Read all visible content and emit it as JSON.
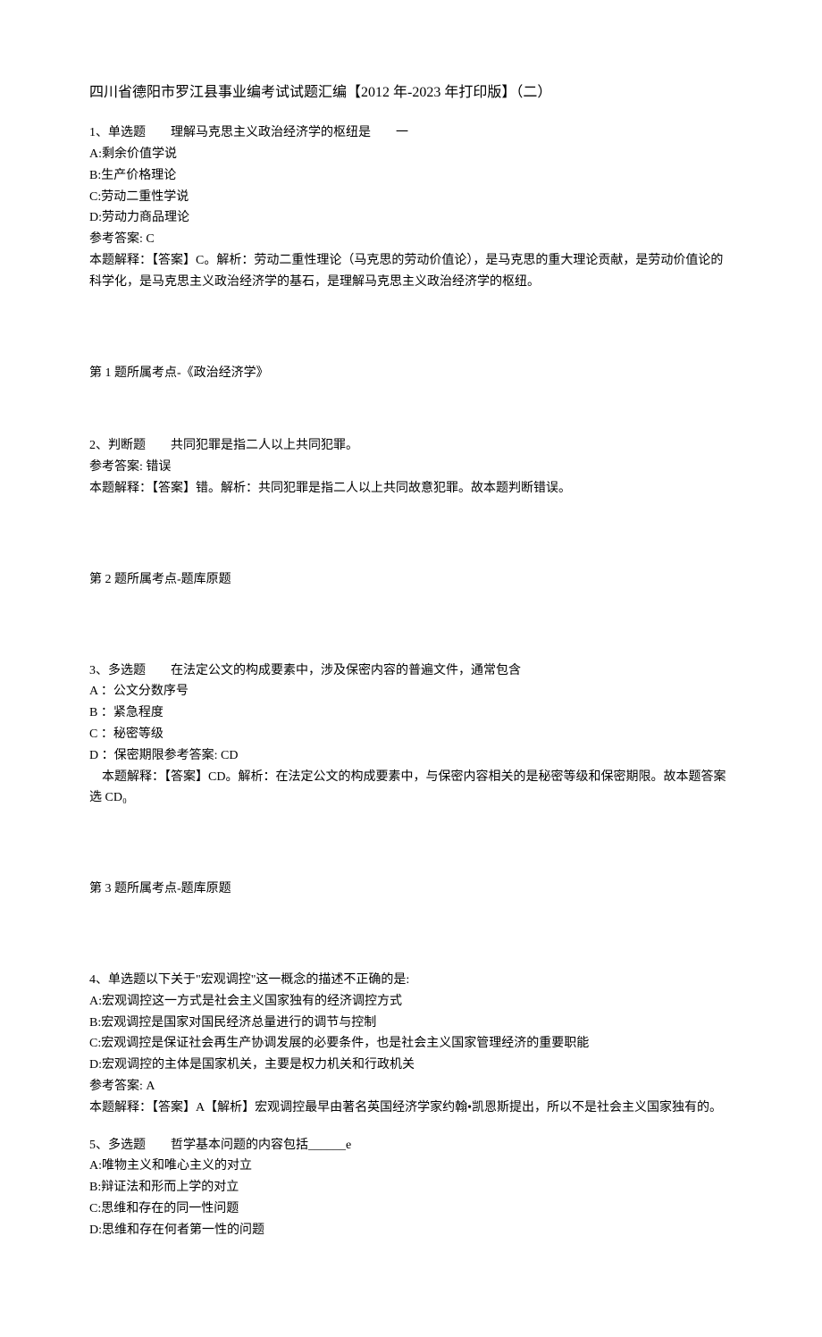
{
  "title": "四川省德阳市罗江县事业编考试试题汇编【2012 年-2023 年打印版】（二）",
  "q1": {
    "stem": "1、单选题　　理解马克思主义政治经济学的枢纽是　　一",
    "optA": "A:剩余价值学说",
    "optB": "B:生产价格理论",
    "optC": "C:劳动二重性学说",
    "optD": "D:劳动力商品理论",
    "ans": "参考答案: C",
    "exp": "本题解释：【答案】C。解析：劳动二重性理论（马克思的劳动价值论），是马克思的重大理论贡献，是劳动价值论的科学化，是马克思主义政治经济学的基石，是理解马克思主义政治经济学的枢纽。",
    "topic": "第 1 题所属考点-《政治经济学》"
  },
  "q2": {
    "stem": "2、判断题　　共同犯罪是指二人以上共同犯罪。",
    "ans": "参考答案: 错误",
    "exp": "本题解释：【答案】错。解析：共同犯罪是指二人以上共同故意犯罪。故本题判断错误。",
    "topic": "第 2 题所属考点-题库原题"
  },
  "q3": {
    "stem": "3、多选题　　在法定公文的构成要素中，涉及保密内容的普遍文件，通常包含",
    "optA": "A ：公文分数序号",
    "optB": "B ：紧急程度",
    "optC": "C ：秘密等级",
    "optD": "D ：保密期限参考答案: CD",
    "exp": "　本题解释：【答案】CD。解析：在法定公文的构成要素中，与保密内容相关的是秘密等级和保密期限。故本题答案选 CD₀",
    "topic": "第 3 题所属考点-题库原题"
  },
  "q4": {
    "stem": "4、单选题以下关于\"宏观调控\"这一概念的描述不正确的是:",
    "optA": "A:宏观调控这一方式是社会主义国家独有的经济调控方式",
    "optB": "B:宏观调控是国家对国民经济总量进行的调节与控制",
    "optC": "C:宏观调控是保证社会再生产协调发展的必要条件，也是社会主义国家管理经济的重要职能",
    "optD": "D:宏观调控的主体是国家机关，主要是权力机关和行政机关",
    "ans": "参考答案: A",
    "exp": "本题解释：【答案】A【解析】宏观调控最早由著名英国经济学家约翰•凯恩斯提出，所以不是社会主义国家独有的。"
  },
  "q5": {
    "stem": "5、多选题　　哲学基本问题的内容包括______e",
    "optA": "A:唯物主义和唯心主义的对立",
    "optB": "B:辩证法和形而上学的对立",
    "optC": "C:思维和存在的同一性问题",
    "optD": "D:思维和存在何者第一性的问题"
  }
}
